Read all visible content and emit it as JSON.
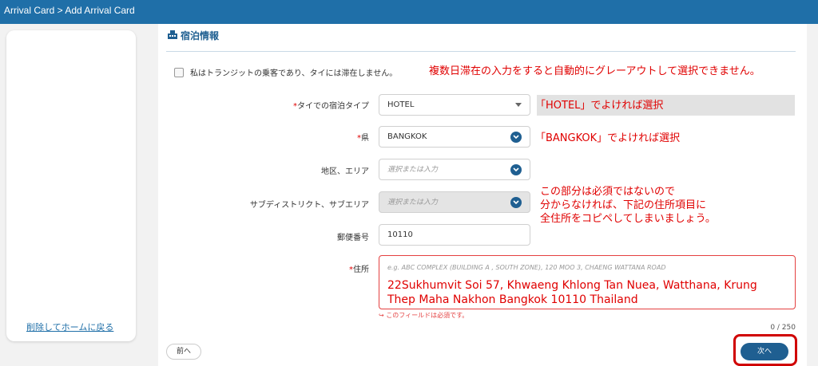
{
  "topbar": {
    "breadcrumb": "Arrival Card > Add Arrival Card"
  },
  "sidebar": {
    "home_link": "削除してホームに戻る"
  },
  "section": {
    "title": "宿泊情報",
    "icon": "building-icon"
  },
  "transit": {
    "label": "私はトランジットの乗客であり、タイには滞在しません。",
    "checked": false
  },
  "fields": {
    "accommodation_type": {
      "label": "タイでの宿泊タイプ",
      "required": "*",
      "value": "HOTEL"
    },
    "province": {
      "label": "県",
      "required": "*",
      "value": "BANGKOK"
    },
    "district": {
      "label": "地区、エリア",
      "placeholder": "選択または入力"
    },
    "subdistrict": {
      "label": "サブディストリクト、サブエリア",
      "placeholder": "選択または入力"
    },
    "postal_code": {
      "label": "郵便番号",
      "value": "10110"
    },
    "address": {
      "label": "住所",
      "required": "*",
      "placeholder": "e.g. ABC COMPLEX (BUILDING A , SOUTH ZONE), 120 MOO 3, CHAENG WATTANA ROAD",
      "value": "22Sukhumvit Soi 57, Khwaeng Khlong Tan Nuea, Watthana, Krung Thep Maha Nakhon Bangkok 10110 Thailand",
      "error": "↪ このフィールドは必須です。",
      "counter": "0 / 250"
    }
  },
  "annotations": {
    "transit_note": "複数日滞在の入力をすると自動的にグレーアウトして選択できません。",
    "hotel_note": "「HOTEL」でよければ選択",
    "bangkok_note": "「BANGKOK」でよければ選択",
    "optional_note_1": "この部分は必須ではないので",
    "optional_note_2": "分からなければ、下記の住所項目に",
    "optional_note_3": "全住所をコピペしてしまいましょう。"
  },
  "buttons": {
    "prev": "前へ",
    "next": "次へ"
  },
  "colors": {
    "primary": "#1f5f91",
    "topbar": "#1f6fa8",
    "annotation": "#e00000"
  }
}
